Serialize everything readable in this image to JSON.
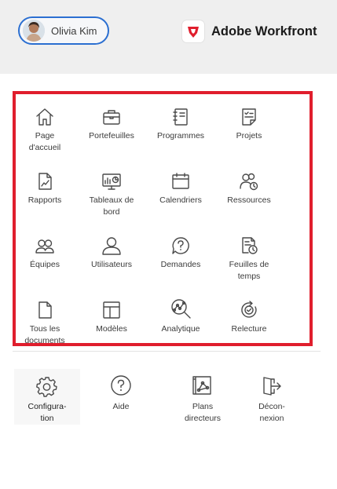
{
  "header": {
    "user_name": "Olivia Kim",
    "brand_name": "Adobe Workfront",
    "brand_color": "#e01e2d"
  },
  "menu": {
    "highlight_color": "#e01e2d",
    "items": [
      {
        "label": "Page\nd'accueil",
        "icon": "home-icon"
      },
      {
        "label": "Portefeuilles",
        "icon": "briefcase-icon"
      },
      {
        "label": "Programmes",
        "icon": "notebook-icon"
      },
      {
        "label": "Projets",
        "icon": "project-icon"
      },
      {
        "label": "Rapports",
        "icon": "report-icon"
      },
      {
        "label": "Tableaux de\nbord",
        "icon": "dashboard-icon"
      },
      {
        "label": "Calendriers",
        "icon": "calendar-icon"
      },
      {
        "label": "Ressources",
        "icon": "resources-icon"
      },
      {
        "label": "Équipes",
        "icon": "teams-icon"
      },
      {
        "label": "Utilisateurs",
        "icon": "user-icon"
      },
      {
        "label": "Demandes",
        "icon": "requests-icon"
      },
      {
        "label": "Feuilles de\ntemps",
        "icon": "timesheet-icon"
      },
      {
        "label": "Tous les\ndocuments",
        "icon": "document-icon"
      },
      {
        "label": "Modèles",
        "icon": "template-icon"
      },
      {
        "label": "Analytique",
        "icon": "analytics-icon"
      },
      {
        "label": "Relecture",
        "icon": "proof-icon"
      }
    ]
  },
  "bottom": {
    "items": [
      {
        "label": "Configura-\ntion",
        "icon": "gear-icon"
      },
      {
        "label": "Aide",
        "icon": "help-icon"
      },
      {
        "label": "Plans\ndirecteurs",
        "icon": "blueprint-icon"
      },
      {
        "label": "Décon-\nnexion",
        "icon": "logout-icon"
      }
    ]
  }
}
